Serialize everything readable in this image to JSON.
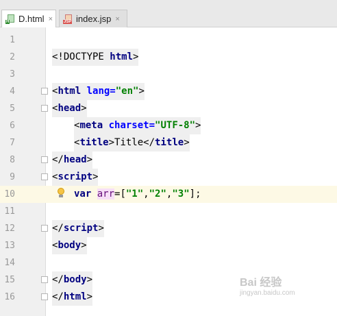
{
  "tabs": [
    {
      "label": "D.html",
      "icon": "html-file-icon",
      "badge": "H",
      "close": "×"
    },
    {
      "label": "index.jsp",
      "icon": "jsp-file-icon",
      "badge": "JSP",
      "close": "×"
    }
  ],
  "editor": {
    "current_line": 10,
    "lines": [
      {
        "n": "1",
        "tokens": []
      },
      {
        "n": "2",
        "tokens": [
          {
            "t": "<!DOCTYPE ",
            "c": "tag"
          },
          {
            "t": "html",
            "c": "kw"
          },
          {
            "t": ">",
            "c": "tag"
          }
        ]
      },
      {
        "n": "3",
        "tokens": []
      },
      {
        "n": "4",
        "tokens": [
          {
            "t": "<",
            "c": "tag"
          },
          {
            "t": "html ",
            "c": "kw"
          },
          {
            "t": "lang=",
            "c": "attr"
          },
          {
            "t": "\"en\"",
            "c": "str"
          },
          {
            "t": ">",
            "c": "tag"
          }
        ]
      },
      {
        "n": "5",
        "tokens": [
          {
            "t": "<",
            "c": "tag"
          },
          {
            "t": "head",
            "c": "kw"
          },
          {
            "t": ">",
            "c": "tag"
          }
        ]
      },
      {
        "n": "6",
        "tokens": [
          {
            "t": "<",
            "c": "tag"
          },
          {
            "t": "meta ",
            "c": "kw"
          },
          {
            "t": "charset=",
            "c": "attr"
          },
          {
            "t": "\"UTF-8\"",
            "c": "str"
          },
          {
            "t": ">",
            "c": "tag"
          }
        ]
      },
      {
        "n": "7",
        "tokens": [
          {
            "t": "<",
            "c": "tag"
          },
          {
            "t": "title",
            "c": "kw"
          },
          {
            "t": ">Title</",
            "c": "tag"
          },
          {
            "t": "title",
            "c": "kw"
          },
          {
            "t": ">",
            "c": "tag"
          }
        ]
      },
      {
        "n": "8",
        "tokens": [
          {
            "t": "</",
            "c": "tag"
          },
          {
            "t": "head",
            "c": "kw"
          },
          {
            "t": ">",
            "c": "tag"
          }
        ]
      },
      {
        "n": "9",
        "tokens": [
          {
            "t": "<",
            "c": "tag"
          },
          {
            "t": "script",
            "c": "kw"
          },
          {
            "t": ">",
            "c": "tag"
          }
        ]
      },
      {
        "n": "10",
        "tokens": [
          {
            "t": "var ",
            "c": "kw"
          },
          {
            "t": "arr",
            "c": "var"
          },
          {
            "t": "=[",
            "c": "plain"
          },
          {
            "t": "\"1\"",
            "c": "str"
          },
          {
            "t": ",",
            "c": "plain"
          },
          {
            "t": "\"2\"",
            "c": "str"
          },
          {
            "t": ",",
            "c": "plain"
          },
          {
            "t": "\"3\"",
            "c": "str"
          },
          {
            "t": "];",
            "c": "plain"
          }
        ]
      },
      {
        "n": "11",
        "tokens": []
      },
      {
        "n": "12",
        "tokens": [
          {
            "t": "</",
            "c": "tag"
          },
          {
            "t": "script",
            "c": "kw"
          },
          {
            "t": ">",
            "c": "tag"
          }
        ]
      },
      {
        "n": "13",
        "tokens": [
          {
            "t": "<",
            "c": "tag"
          },
          {
            "t": "body",
            "c": "kw"
          },
          {
            "t": ">",
            "c": "tag"
          }
        ]
      },
      {
        "n": "14",
        "tokens": []
      },
      {
        "n": "15",
        "tokens": [
          {
            "t": "</",
            "c": "tag"
          },
          {
            "t": "body",
            "c": "kw"
          },
          {
            "t": ">",
            "c": "tag"
          }
        ]
      },
      {
        "n": "16",
        "tokens": [
          {
            "t": "</",
            "c": "tag"
          },
          {
            "t": "html",
            "c": "kw"
          },
          {
            "t": ">",
            "c": "tag"
          }
        ]
      }
    ]
  },
  "watermark": {
    "line1": "Bai 经验",
    "line2": "jingyan.baidu.com"
  }
}
